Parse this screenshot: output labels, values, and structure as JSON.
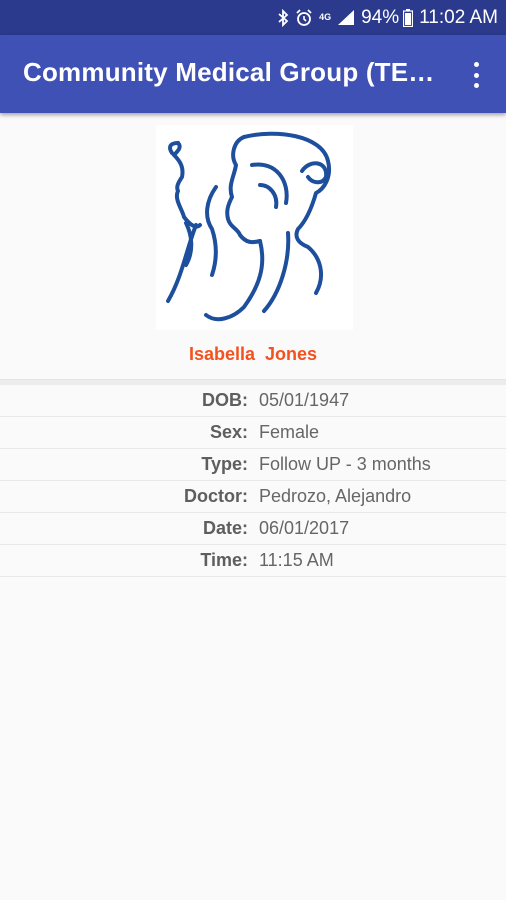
{
  "status_bar": {
    "network": "4G",
    "battery": "94%",
    "time": "11:02 AM"
  },
  "app_bar": {
    "title": "Community Medical Group (TE…",
    "menu_icon": "more-vert-icon"
  },
  "patient": {
    "name": "Isabella  Jones",
    "photo_icon": "profile-silhouette-logo"
  },
  "details": [
    {
      "label": "DOB:",
      "value": "05/01/1947"
    },
    {
      "label": "Sex:",
      "value": "Female"
    },
    {
      "label": "Type:",
      "value": "Follow UP - 3 months"
    },
    {
      "label": "Doctor:",
      "value": "Pedrozo, Alejandro"
    },
    {
      "label": "Date:",
      "value": "06/01/2017"
    },
    {
      "label": "Time:",
      "value": "11:15 AM"
    }
  ],
  "colors": {
    "status_bar": "#2b3a8d",
    "app_bar": "#3f51b5",
    "patient_name": "#f4511e",
    "logo": "#1e4f9c"
  }
}
